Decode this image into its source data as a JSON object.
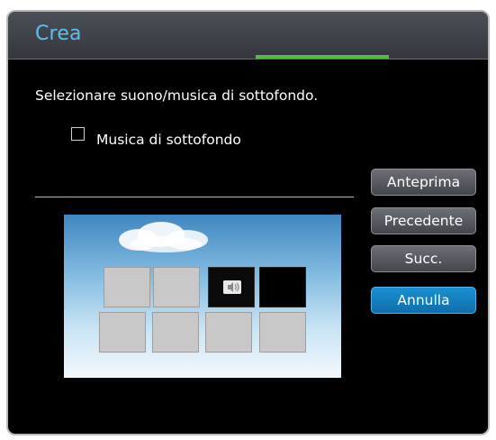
{
  "dialog": {
    "title": "Crea",
    "instruction": "Selezionare suono/musica di sottofondo.",
    "checkbox": {
      "label": "Musica di sottofondo",
      "checked": false
    }
  },
  "buttons": {
    "preview": "Anteprima",
    "previous": "Precedente",
    "next": "Succ.",
    "cancel": "Annulla"
  },
  "colors": {
    "title": "#5bc0f0",
    "progress": "#58b84a",
    "active_button": "#1a8fd0"
  },
  "preview_grid": {
    "tiles": [
      {
        "type": "image"
      },
      {
        "type": "image"
      },
      {
        "type": "sound",
        "icon": "speaker-icon"
      },
      {
        "type": "empty"
      },
      {
        "type": "image"
      },
      {
        "type": "image"
      },
      {
        "type": "image"
      },
      {
        "type": "image"
      }
    ]
  }
}
